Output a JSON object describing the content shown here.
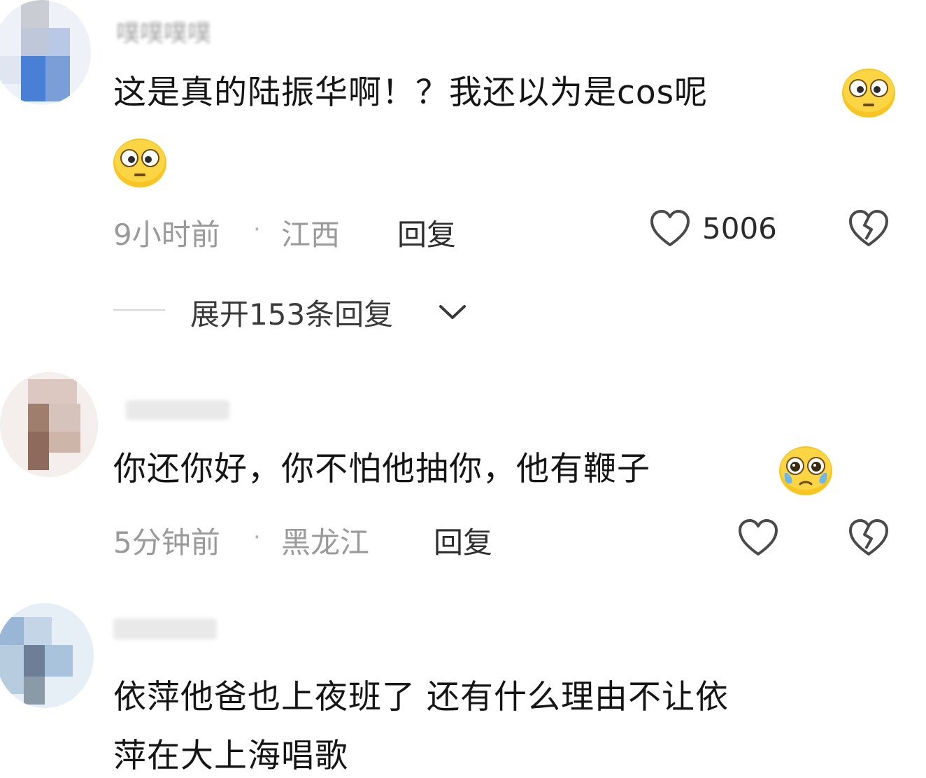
{
  "comments": [
    {
      "username": "噗噗噗噗",
      "text_line1": "这是真的陆振华啊！？我还以为是cos呢",
      "time": "9小时前",
      "separator": "·",
      "location": "江西",
      "reply_label": "回复",
      "likes": "5006",
      "expand_replies": "展开153条回复",
      "emoji": "flushed-face-emoji"
    },
    {
      "username": "",
      "text_line1": "你还你好，你不怕他抽你，他有鞭子",
      "time": "5分钟前",
      "separator": "·",
      "location": "黑龙江",
      "reply_label": "回复",
      "emoji": "pleading-face-emoji"
    },
    {
      "username": "",
      "text_line1": "依萍他爸也上夜班了 还有什么理由不让依",
      "text_line2": "萍在大上海唱歌"
    }
  ],
  "icons": {
    "like": "heart-outline-icon",
    "dislike": "broken-heart-icon",
    "expand": "chevron-down-icon"
  },
  "colors": {
    "text": "#151515",
    "meta": "#9a9a9a",
    "emoji_yellow": "#f7c624"
  }
}
